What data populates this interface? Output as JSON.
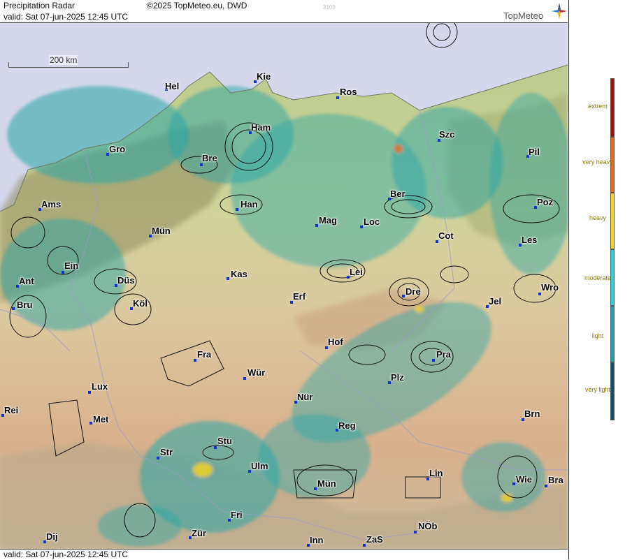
{
  "header": {
    "title": "Precipitation Radar",
    "copyright": "©2025 TopMeteo.eu, DWD",
    "valid": "valid:  Sat  07-jun-2025 12:45 UTC",
    "code": "3100",
    "logo": "TopMeteo"
  },
  "footer": {
    "valid": "valid:  Sat  07-jun-2025 12:45 UTC"
  },
  "scale": {
    "label": "200 km"
  },
  "legend": {
    "levels": [
      {
        "label": "extrem",
        "color": "#a30e0e"
      },
      {
        "label": "very heavy",
        "color": "#ef6a17"
      },
      {
        "label": "heavy",
        "color": "#f7d51c"
      },
      {
        "label": "moderate",
        "color": "#22d6dc"
      },
      {
        "label": "light",
        "color": "#1ea0a8"
      },
      {
        "label": "very light",
        "color": "#164a66"
      }
    ]
  },
  "cities": [
    {
      "name": "Hel"
    },
    {
      "name": "Kie"
    },
    {
      "name": "Ros"
    },
    {
      "name": "Ham"
    },
    {
      "name": "Szc"
    },
    {
      "name": "Gro"
    },
    {
      "name": "Bre"
    },
    {
      "name": "Pil"
    },
    {
      "name": "Ams"
    },
    {
      "name": "Han"
    },
    {
      "name": "Ber"
    },
    {
      "name": "Poz"
    },
    {
      "name": "Mün"
    },
    {
      "name": "Mag"
    },
    {
      "name": "Loc"
    },
    {
      "name": "Cot"
    },
    {
      "name": "Les"
    },
    {
      "name": "Ein"
    },
    {
      "name": "Kas"
    },
    {
      "name": "Lei"
    },
    {
      "name": "Ant"
    },
    {
      "name": "Düs"
    },
    {
      "name": "Wro"
    },
    {
      "name": "Bru"
    },
    {
      "name": "Köl"
    },
    {
      "name": "Erf"
    },
    {
      "name": "Dre"
    },
    {
      "name": "Jel"
    },
    {
      "name": "Hof"
    },
    {
      "name": "Fra"
    },
    {
      "name": "Pra"
    },
    {
      "name": "Wür"
    },
    {
      "name": "Plz"
    },
    {
      "name": "Lux"
    },
    {
      "name": "Nür"
    },
    {
      "name": "Rei"
    },
    {
      "name": "Met"
    },
    {
      "name": "Reg"
    },
    {
      "name": "Brn"
    },
    {
      "name": "Stu"
    },
    {
      "name": "Str"
    },
    {
      "name": "Ulm"
    },
    {
      "name": "Lin"
    },
    {
      "name": "Mün"
    },
    {
      "name": "Wie"
    },
    {
      "name": "Bra"
    },
    {
      "name": "Fri"
    },
    {
      "name": "Zür"
    },
    {
      "name": "NÖb"
    },
    {
      "name": "Dij"
    },
    {
      "name": "Inn"
    },
    {
      "name": "ZaS"
    }
  ]
}
